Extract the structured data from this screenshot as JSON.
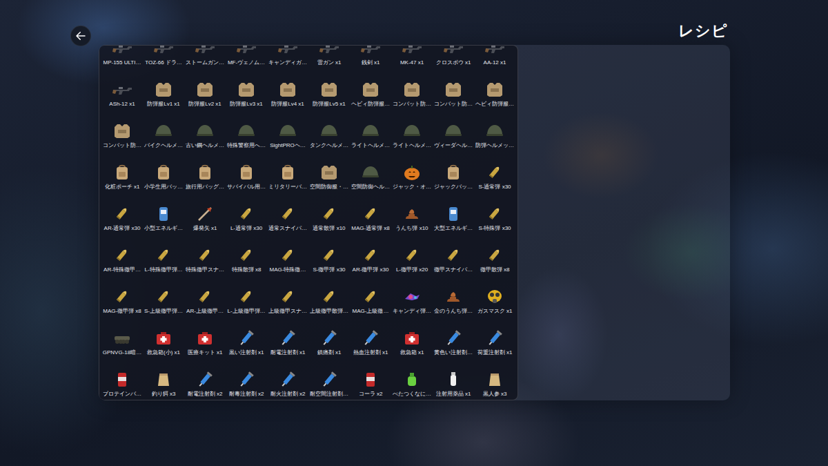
{
  "screen": {
    "title": "レシピ"
  },
  "recipes": [
    {
      "label": "MP-155 ULTI…",
      "kind": "gun"
    },
    {
      "label": "TOZ-66 ドラ…",
      "kind": "gun"
    },
    {
      "label": "ストームガン…",
      "kind": "gun"
    },
    {
      "label": "MF-ヴェノム…",
      "kind": "gun"
    },
    {
      "label": "キャンディガ…",
      "kind": "gun"
    },
    {
      "label": "雷ガン x1",
      "kind": "gun"
    },
    {
      "label": "銭剣 x1",
      "kind": "gun"
    },
    {
      "label": "MK-47 x1",
      "kind": "gun"
    },
    {
      "label": "クロスボウ x1",
      "kind": "gun"
    },
    {
      "label": "AA-12 x1",
      "kind": "gun"
    },
    {
      "label": "ASh-12 x1",
      "kind": "gun"
    },
    {
      "label": "防弾服Lv1 x1",
      "kind": "armor"
    },
    {
      "label": "防弾服Lv2 x1",
      "kind": "armor"
    },
    {
      "label": "防弾服Lv3 x1",
      "kind": "armor"
    },
    {
      "label": "防弾服Lv4 x1",
      "kind": "armor"
    },
    {
      "label": "防弾服Lv5 x1",
      "kind": "armor"
    },
    {
      "label": "ヘビィ防弾服…",
      "kind": "armor"
    },
    {
      "label": "コンバット防…",
      "kind": "armor"
    },
    {
      "label": "コンバット防…",
      "kind": "armor"
    },
    {
      "label": "ヘビィ防弾服…",
      "kind": "armor"
    },
    {
      "label": "コンバット防…",
      "kind": "armor"
    },
    {
      "label": "バイクヘルメ…",
      "kind": "helmet"
    },
    {
      "label": "古い鋼ヘルメ…",
      "kind": "helmet"
    },
    {
      "label": "特殊警察用へ…",
      "kind": "helmet"
    },
    {
      "label": "SightPROヘ…",
      "kind": "helmet"
    },
    {
      "label": "タンクヘルメ…",
      "kind": "helmet"
    },
    {
      "label": "ライトヘルメ…",
      "kind": "helmet"
    },
    {
      "label": "ライトヘルメ…",
      "kind": "helmet"
    },
    {
      "label": "ヴィーダヘル…",
      "kind": "helmet"
    },
    {
      "label": "防弾ヘルメッ…",
      "kind": "helmet"
    },
    {
      "label": "化粧ポーチ x1",
      "kind": "bag"
    },
    {
      "label": "小学生用バッ…",
      "kind": "bag"
    },
    {
      "label": "旅行用バッグ…",
      "kind": "bag"
    },
    {
      "label": "サバイバル用…",
      "kind": "bag"
    },
    {
      "label": "ミリタリーバ…",
      "kind": "bag"
    },
    {
      "label": "空間防御服・…",
      "kind": "armor"
    },
    {
      "label": "空間防御ヘル…",
      "kind": "helmet"
    },
    {
      "label": "ジャック・オ…",
      "kind": "pumpkin"
    },
    {
      "label": "ジャックバッ…",
      "kind": "bag"
    },
    {
      "label": "S-通常弾 x30",
      "kind": "ammo"
    },
    {
      "label": "AR-通常弾 x30",
      "kind": "ammo"
    },
    {
      "label": "小型エネルギ…",
      "kind": "cell"
    },
    {
      "label": "爆発矢 x1",
      "kind": "arrow"
    },
    {
      "label": "L-通常弾 x30",
      "kind": "ammo"
    },
    {
      "label": "通常スナイパ…",
      "kind": "ammo"
    },
    {
      "label": "通常散弾 x10",
      "kind": "ammo"
    },
    {
      "label": "MAG-通常弾 x8",
      "kind": "ammo"
    },
    {
      "label": "うんち弾 x10",
      "kind": "poop"
    },
    {
      "label": "大型エネルギ…",
      "kind": "cell"
    },
    {
      "label": "S-特殊弾 x30",
      "kind": "ammo"
    },
    {
      "label": "AR-特殊徹甲…",
      "kind": "ammo"
    },
    {
      "label": "L-特殊徹甲弾…",
      "kind": "ammo"
    },
    {
      "label": "特殊徹甲スナ…",
      "kind": "ammo"
    },
    {
      "label": "特殊散弾 x8",
      "kind": "ammo"
    },
    {
      "label": "MAG-特殊徹…",
      "kind": "ammo"
    },
    {
      "label": "S-徹甲弾 x30",
      "kind": "ammo"
    },
    {
      "label": "AR-徹甲弾 x30",
      "kind": "ammo"
    },
    {
      "label": "L-徹甲弾 x20",
      "kind": "ammo"
    },
    {
      "label": "徹甲スナイパ…",
      "kind": "ammo"
    },
    {
      "label": "徹甲散弾 x8",
      "kind": "ammo"
    },
    {
      "label": "MAG-徹甲弾 x8",
      "kind": "ammo"
    },
    {
      "label": "S-上級徹甲弾…",
      "kind": "ammo"
    },
    {
      "label": "AR-上級徹甲…",
      "kind": "ammo"
    },
    {
      "label": "L-上級徹甲弾…",
      "kind": "ammo"
    },
    {
      "label": "上級徹甲スナ…",
      "kind": "ammo"
    },
    {
      "label": "上級徹甲散弾…",
      "kind": "ammo"
    },
    {
      "label": "MAG-上級徹…",
      "kind": "ammo"
    },
    {
      "label": "キャンディ弾…",
      "kind": "candy"
    },
    {
      "label": "金のうんち弾…",
      "kind": "poop"
    },
    {
      "label": "ガスマスク x1",
      "kind": "mask"
    },
    {
      "label": "GPNVG-18暗…",
      "kind": "goggles"
    },
    {
      "label": "救急箱(小) x1",
      "kind": "medkit"
    },
    {
      "label": "医療キット x1",
      "kind": "medkit"
    },
    {
      "label": "黒い注射剤 x1",
      "kind": "syringe"
    },
    {
      "label": "耐電注射剤 x1",
      "kind": "syringe"
    },
    {
      "label": "鎮痛剤 x1",
      "kind": "syringe"
    },
    {
      "label": "熱血注射剤 x1",
      "kind": "syringe"
    },
    {
      "label": "救急箱 x1",
      "kind": "medkit"
    },
    {
      "label": "黄色い注射剤…",
      "kind": "syringe"
    },
    {
      "label": "荷重注射剤 x1",
      "kind": "syringe"
    },
    {
      "label": "プロテインバ…",
      "kind": "can"
    },
    {
      "label": "釣り餌 x3",
      "kind": "food"
    },
    {
      "label": "耐電注射剤 x2",
      "kind": "syringe"
    },
    {
      "label": "耐毒注射剤 x2",
      "kind": "syringe"
    },
    {
      "label": "耐火注射剤 x2",
      "kind": "syringe"
    },
    {
      "label": "耐空間注射剤…",
      "kind": "syringe"
    },
    {
      "label": "コーラ x2",
      "kind": "can"
    },
    {
      "label": "べたつくなに…",
      "kind": "bottle"
    },
    {
      "label": "注射用薬品 x1",
      "kind": "vial"
    },
    {
      "label": "黒人参 x3",
      "kind": "food"
    }
  ]
}
